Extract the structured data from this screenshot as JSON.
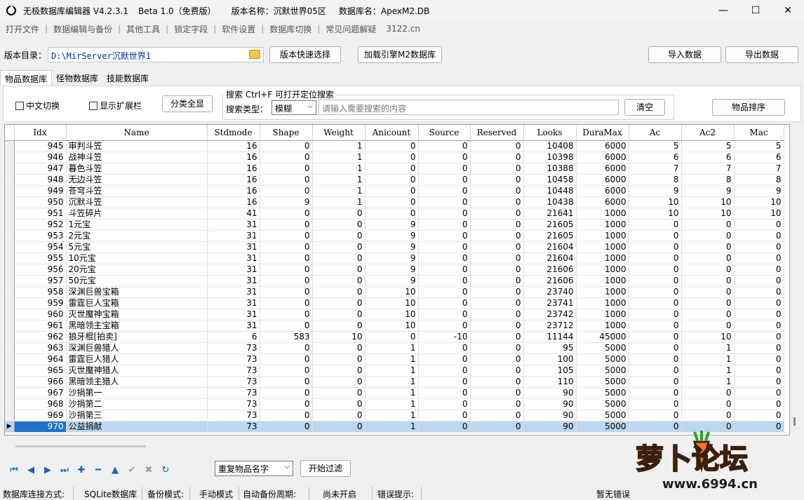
{
  "titlebar": {
    "app_name": "无极数据库编辑器 V4.2.3.1",
    "edition": "Beta 1.0（免费版）",
    "version_label": "版本名称：沉默世界05区",
    "db_label": "数据库名：ApexM2.DB"
  },
  "window_controls": {
    "minimize": "—",
    "maximize": "☐",
    "close": "✕"
  },
  "menu": [
    "打开文件",
    "数据编辑与备份",
    "其他工具",
    "锁定字段",
    "软件设置",
    "数据库切换",
    "常见问题解疑",
    "3122.cn"
  ],
  "pathbar": {
    "label": "版本目录：",
    "path": "D:\\MirServer沉默世界1",
    "quick_select": "版本快速选择",
    "load_engine": "加载引擎M2数据库",
    "import": "导入数据",
    "export": "导出数据"
  },
  "tabs": [
    "物品数据库",
    "怪物数据库",
    "技能数据库"
  ],
  "filters": {
    "chinese_toggle": "中文切换",
    "show_ext": "显示扩展栏",
    "show_all": "分类全显",
    "search_title": "搜索  Ctrl+F 可打开定位搜索",
    "search_type_label": "搜索类型：",
    "search_type_value": "模糊",
    "search_placeholder": "请输入需要搜索的内容",
    "clear": "清空",
    "sort": "物品排序"
  },
  "table": {
    "columns": [
      "Idx",
      "Name",
      "Stdmode",
      "Shape",
      "Weight",
      "Anicount",
      "Source",
      "Reserved",
      "Looks",
      "DuraMax",
      "Ac",
      "Ac2",
      "Mac"
    ],
    "rows": [
      [
        "945",
        "审判斗笠",
        "16",
        "0",
        "1",
        "0",
        "0",
        "0",
        "10408",
        "6000",
        "5",
        "5",
        "5"
      ],
      [
        "946",
        "战神斗笠",
        "16",
        "0",
        "1",
        "0",
        "0",
        "0",
        "10398",
        "6000",
        "6",
        "6",
        "6"
      ],
      [
        "947",
        "暮色斗笠",
        "16",
        "0",
        "1",
        "0",
        "0",
        "0",
        "10388",
        "6000",
        "7",
        "7",
        "7"
      ],
      [
        "948",
        "无边斗笠",
        "16",
        "0",
        "1",
        "0",
        "0",
        "0",
        "10458",
        "6000",
        "8",
        "8",
        "8"
      ],
      [
        "949",
        "苍穹斗笠",
        "16",
        "0",
        "1",
        "0",
        "0",
        "0",
        "10448",
        "6000",
        "9",
        "9",
        "9"
      ],
      [
        "950",
        "沉默斗笠",
        "16",
        "9",
        "1",
        "0",
        "0",
        "0",
        "10438",
        "6000",
        "10",
        "10",
        "10"
      ],
      [
        "951",
        "斗笠碎片",
        "41",
        "0",
        "0",
        "0",
        "0",
        "0",
        "21641",
        "1000",
        "10",
        "10",
        "10"
      ],
      [
        "952",
        "1元宝",
        "31",
        "0",
        "0",
        "9",
        "0",
        "0",
        "21605",
        "1000",
        "0",
        "0",
        "0"
      ],
      [
        "953",
        "2元宝",
        "31",
        "0",
        "0",
        "9",
        "0",
        "0",
        "21605",
        "1000",
        "0",
        "0",
        "0"
      ],
      [
        "954",
        "5元宝",
        "31",
        "0",
        "0",
        "9",
        "0",
        "0",
        "21604",
        "1000",
        "0",
        "0",
        "0"
      ],
      [
        "955",
        "10元宝",
        "31",
        "0",
        "0",
        "9",
        "0",
        "0",
        "21604",
        "1000",
        "0",
        "0",
        "0"
      ],
      [
        "956",
        "20元宝",
        "31",
        "0",
        "0",
        "9",
        "0",
        "0",
        "21606",
        "1000",
        "0",
        "0",
        "0"
      ],
      [
        "957",
        "50元宝",
        "31",
        "0",
        "0",
        "9",
        "0",
        "0",
        "21606",
        "1000",
        "0",
        "0",
        "0"
      ],
      [
        "958",
        "深渊巨兽宝箱",
        "31",
        "0",
        "0",
        "10",
        "0",
        "0",
        "23740",
        "1000",
        "0",
        "0",
        "0"
      ],
      [
        "959",
        "雷霆巨人宝箱",
        "31",
        "0",
        "0",
        "10",
        "0",
        "0",
        "23741",
        "1000",
        "0",
        "0",
        "0"
      ],
      [
        "960",
        "灭世魔神宝箱",
        "31",
        "0",
        "0",
        "10",
        "0",
        "0",
        "23742",
        "1000",
        "0",
        "0",
        "0"
      ],
      [
        "961",
        "黑暗领主宝箱",
        "31",
        "0",
        "0",
        "10",
        "0",
        "0",
        "23712",
        "1000",
        "0",
        "0",
        "0"
      ],
      [
        "962",
        "狼牙棍[拍卖]",
        "6",
        "583",
        "10",
        "0",
        "-10",
        "0",
        "11144",
        "45000",
        "0",
        "10",
        "0"
      ],
      [
        "963",
        "深渊巨兽猎人",
        "73",
        "0",
        "0",
        "1",
        "0",
        "0",
        "95",
        "5000",
        "0",
        "1",
        "0"
      ],
      [
        "964",
        "雷霆巨人猎人",
        "73",
        "0",
        "0",
        "1",
        "0",
        "0",
        "100",
        "5000",
        "0",
        "1",
        "0"
      ],
      [
        "965",
        "灭世魔神猎人",
        "73",
        "0",
        "0",
        "1",
        "0",
        "0",
        "105",
        "5000",
        "0",
        "1",
        "0"
      ],
      [
        "966",
        "黑暗领主猎人",
        "73",
        "0",
        "0",
        "1",
        "0",
        "0",
        "110",
        "5000",
        "0",
        "1",
        "0"
      ],
      [
        "967",
        "沙捐第一",
        "73",
        "0",
        "0",
        "1",
        "0",
        "0",
        "90",
        "5000",
        "0",
        "0",
        "0"
      ],
      [
        "968",
        "沙捐第二",
        "73",
        "0",
        "0",
        "1",
        "0",
        "0",
        "90",
        "5000",
        "0",
        "0",
        "0"
      ],
      [
        "969",
        "沙捐第三",
        "73",
        "0",
        "0",
        "1",
        "0",
        "0",
        "90",
        "5000",
        "0",
        "0",
        "0"
      ],
      [
        "970",
        "公益捐献",
        "73",
        "0",
        "0",
        "1",
        "0",
        "0",
        "90",
        "5000",
        "0",
        "0",
        "0"
      ]
    ],
    "selected_row_index": 25
  },
  "bottom": {
    "filter_select": "重复物品名字",
    "filter_button": "开始过滤"
  },
  "nav_icons": [
    "first-icon",
    "prior-icon",
    "next-icon",
    "last-icon",
    "insert-icon",
    "delete-icon",
    "edit-icon",
    "post-icon",
    "cancel-icon",
    "refresh-icon"
  ],
  "statusbar": {
    "conn_label": "数据库连接方式:",
    "conn_value": "SQLite数据库",
    "backup_label": "备份模式:",
    "backup_value": "手动模式",
    "auto_label": "自动备份周期:",
    "auto_value": "尚未开启",
    "err_label": "错误提示:",
    "err_value": "暂无错误"
  },
  "watermark": {
    "title": "萝卜论坛",
    "url": "www.6994.cn"
  }
}
